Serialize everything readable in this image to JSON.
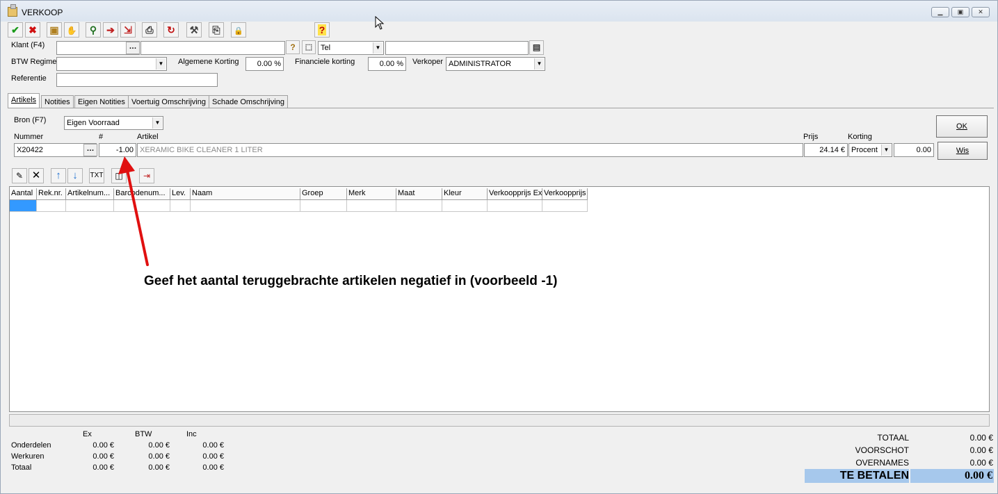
{
  "window": {
    "title": "VERKOOP",
    "controls": [
      "minimize",
      "maximize",
      "close"
    ]
  },
  "toolbar": {
    "buttons": [
      {
        "icon": "checkmark-icon",
        "glyph": "✔",
        "color": "#1a9a1a"
      },
      {
        "icon": "cancel-x-icon",
        "glyph": "✖",
        "color": "#d01010"
      },
      {
        "icon": "package-icon",
        "glyph": "▣",
        "color": "#b08020"
      },
      {
        "icon": "hand-icon",
        "glyph": "✋",
        "color": "#8a3a10"
      },
      {
        "icon": "search-user-icon",
        "glyph": "⚲",
        "color": "#207020"
      },
      {
        "icon": "document-arrow-icon",
        "glyph": "➔",
        "color": "#c02020"
      },
      {
        "icon": "document-import-icon",
        "glyph": "⇲",
        "color": "#c02020"
      },
      {
        "icon": "printer-icon",
        "glyph": "⎙",
        "color": "#333333"
      },
      {
        "icon": "refresh-icon",
        "glyph": "↻",
        "color": "#c01010"
      },
      {
        "icon": "tools-icon",
        "glyph": "⚒",
        "color": "#444444"
      },
      {
        "icon": "print-preview-icon",
        "glyph": "⎘",
        "color": "#444444"
      },
      {
        "icon": "lock-icon",
        "glyph": "🔒",
        "color": "#806020"
      },
      {
        "icon": "help-icon",
        "glyph": "?",
        "color": "#c00000"
      }
    ]
  },
  "header": {
    "klant_label": "Klant (F4)",
    "klant_value": "",
    "klant_name_value": "",
    "tel_value": "Tel",
    "tel_input_value": "",
    "btw_label": "BTW Regime",
    "btw_value": "",
    "algemene_korting_label": "Algemene Korting",
    "algemene_korting_value": "0.00 %",
    "financiele_korting_label": "Financiele korting",
    "financiele_korting_value": "0.00 %",
    "verkoper_label": "Verkoper",
    "verkoper_value": "ADMINISTRATOR",
    "referentie_label": "Referentie",
    "referentie_value": ""
  },
  "tabs": [
    {
      "label": "Artikels",
      "active": true
    },
    {
      "label": "Notities",
      "active": false
    },
    {
      "label": "Eigen Notities",
      "active": false
    },
    {
      "label": "Voertuig Omschrijving",
      "active": false
    },
    {
      "label": "Schade Omschrijving",
      "active": false
    }
  ],
  "entry": {
    "bron_label": "Bron (F7)",
    "bron_value": "Eigen Voorraad",
    "nummer_label": "Nummer",
    "aantal_label": "#",
    "artikel_label": "Artikel",
    "prijs_label": "Prijs",
    "korting_label": "Korting",
    "nummer_value": "X20422",
    "aantal_value": "-1.00",
    "artikel_value": "XERAMIC BIKE CLEANER 1 LITER",
    "prijs_value": "24.14 €",
    "korting_type": "Procent",
    "korting_value": "0.00",
    "ok_label": "OK",
    "wis_label": "Wis"
  },
  "grid_toolbar": {
    "txt_label": "TXT"
  },
  "grid": {
    "columns": [
      "Aantal",
      "Rek.nr.",
      "Artikelnum...",
      "Barcodenum...",
      "Lev.",
      "Naam",
      "Groep",
      "Merk",
      "Maat",
      "Kleur",
      "Verkoopprijs Ex",
      "Verkoopprijs"
    ]
  },
  "totals": {
    "col_ex": "Ex",
    "col_btw": "BTW",
    "col_inc": "Inc",
    "rows": [
      {
        "label": "Onderdelen",
        "ex": "0.00 €",
        "btw": "0.00 €",
        "inc": "0.00 €"
      },
      {
        "label": "Werkuren",
        "ex": "0.00 €",
        "btw": "0.00 €",
        "inc": "0.00 €"
      },
      {
        "label": "Totaal",
        "ex": "0.00 €",
        "btw": "0.00 €",
        "inc": "0.00 €"
      }
    ]
  },
  "summary": {
    "totaal_label": "TOTAAL",
    "totaal_value": "0.00 €",
    "voorschot_label": "VOORSCHOT",
    "voorschot_value": "0.00 €",
    "overnames_label": "OVERNAMES",
    "overnames_value": "0.00 €",
    "te_betalen_label": "TE BETALEN",
    "te_betalen_value": "0.00 €"
  },
  "annotation": {
    "text": "Geef het aantal teruggebrachte artikelen negatief in (voorbeeld -1)",
    "color": "#e01010"
  }
}
